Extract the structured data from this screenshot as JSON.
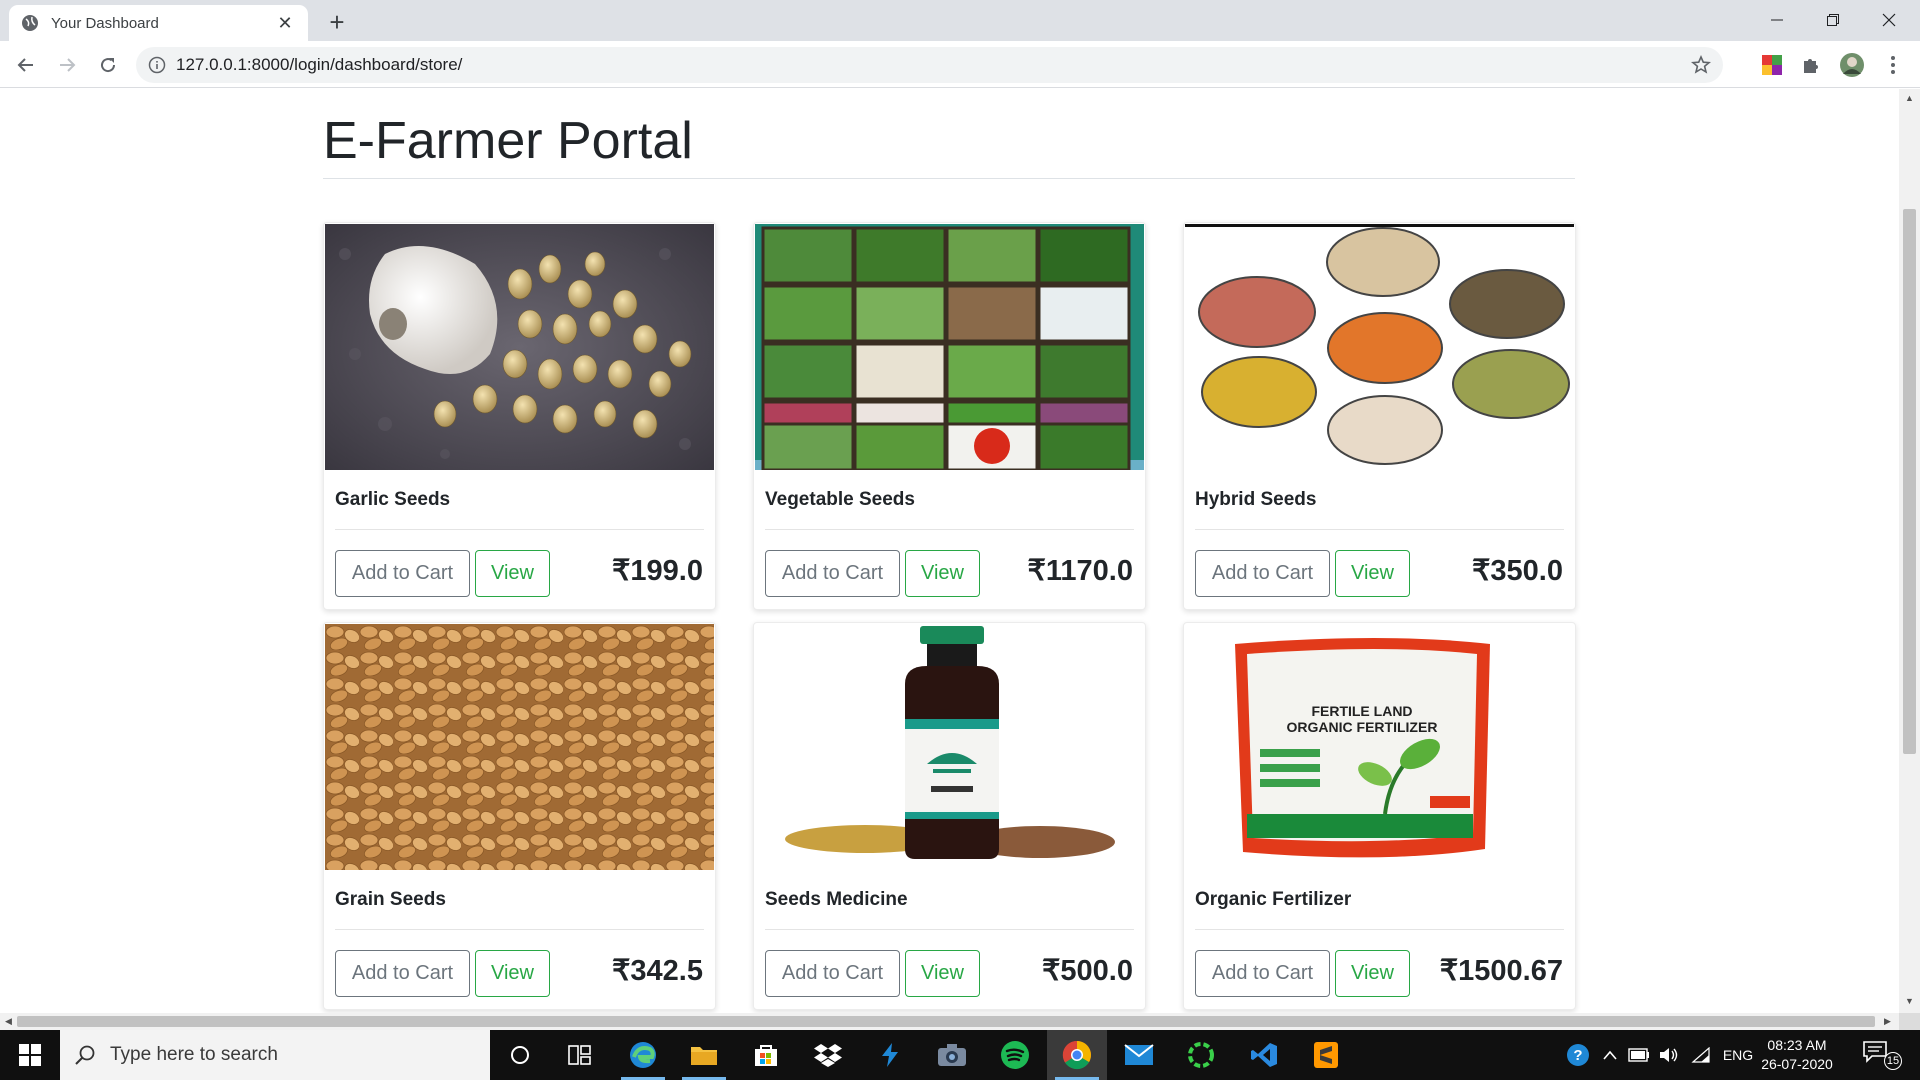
{
  "browser": {
    "tab_title": "Your Dashboard",
    "url": "127.0.0.1:8000/login/dashboard/store/"
  },
  "page": {
    "title": "E-Farmer Portal",
    "add_to_cart_label": "Add to Cart",
    "view_label": "View"
  },
  "products": [
    {
      "name": "Garlic Seeds",
      "price": "₹199.0",
      "image": "garlic-seeds-photo"
    },
    {
      "name": "Vegetable Seeds",
      "price": "₹1170.0",
      "image": "vegetable-seeds-photo"
    },
    {
      "name": "Hybrid Seeds",
      "price": "₹350.0",
      "image": "hybrid-seeds-photo"
    },
    {
      "name": "Grain Seeds",
      "price": "₹342.5",
      "image": "grain-seeds-photo"
    },
    {
      "name": "Seeds Medicine",
      "price": "₹500.0",
      "image": "seeds-medicine-photo"
    },
    {
      "name": "Organic Fertilizer",
      "price": "₹1500.67",
      "image": "organic-fertilizer-photo"
    }
  ],
  "images_text": {
    "fertilizer_line1": "FERTILE LAND",
    "fertilizer_line2": "ORGANIC FERTILIZER"
  },
  "taskbar": {
    "search_placeholder": "Type here to search",
    "language": "ENG",
    "time": "08:23 AM",
    "date": "26-07-2020",
    "notification_count": "15",
    "apps": [
      "task-view",
      "edge",
      "file-explorer",
      "store",
      "dropbox",
      "visual-studio",
      "camera",
      "spotify",
      "chrome",
      "mail",
      "app-ring",
      "vscode",
      "sublime-text"
    ]
  },
  "colors": {
    "view_button": "#28a745",
    "cart_button": "#6c757d",
    "taskbar": "#101010",
    "tab_strip": "#dee1e6"
  }
}
